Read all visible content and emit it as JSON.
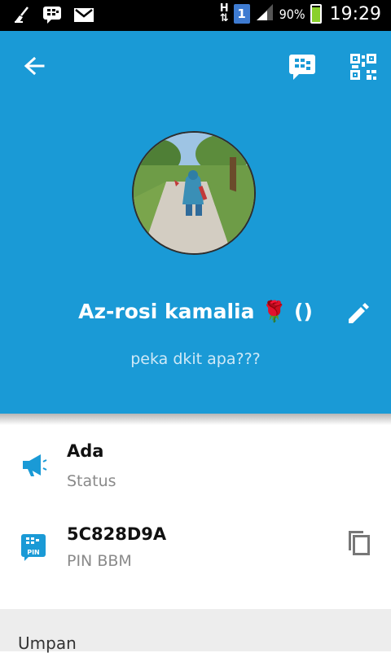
{
  "status_bar": {
    "network_label": "H",
    "sim_slot": "1",
    "battery_percent": "90%",
    "battery_level": 0.9,
    "time": "19:29",
    "notification_icons": [
      "broom-icon",
      "bbm-notification-icon",
      "gmail-icon"
    ]
  },
  "header": {
    "back_icon": "arrow-left-icon",
    "chat_icon": "bbm-chat-icon",
    "qr_icon": "qr-code-icon",
    "display_name": "Az-rosi kamalia 🌹 ()",
    "status_message": "peka dkit apa???",
    "edit_icon": "pencil-icon",
    "background_color": "#1a9ad6"
  },
  "profile_info": [
    {
      "icon": "megaphone-icon",
      "value": "Ada",
      "label": "Status"
    },
    {
      "icon": "bbm-pin-icon",
      "value": "5C828D9A",
      "label": "PIN BBM",
      "action_icon": "copy-icon"
    }
  ],
  "feed": {
    "title": "Umpan"
  },
  "accent_color": "#1a9ad6"
}
